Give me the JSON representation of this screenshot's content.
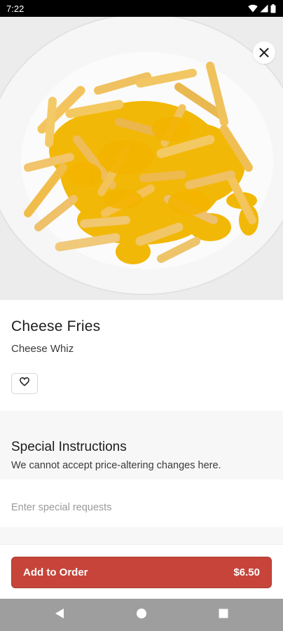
{
  "status_bar": {
    "time": "7:22",
    "icons": [
      "wifi-icon",
      "signal-icon",
      "battery-icon"
    ]
  },
  "hero": {
    "image_alt": "cheese fries on a white plate",
    "close_icon": "close-icon"
  },
  "item": {
    "title": "Cheese Fries",
    "description": "Cheese Whiz",
    "favorite_icon": "heart-outline-icon"
  },
  "special_instructions": {
    "title": "Special Instructions",
    "note": "We cannot accept price-altering changes here.",
    "placeholder": "Enter special requests",
    "value": ""
  },
  "order": {
    "button_label": "Add to Order",
    "price": "$6.50"
  },
  "nav_bar": {
    "buttons": [
      "back-icon",
      "home-icon",
      "recents-icon"
    ]
  },
  "colors": {
    "accent": "#c6443a",
    "section_bg": "#f7f7f7",
    "nav_bar_bg": "#9e9e9e",
    "status_bar_bg": "#000000"
  }
}
